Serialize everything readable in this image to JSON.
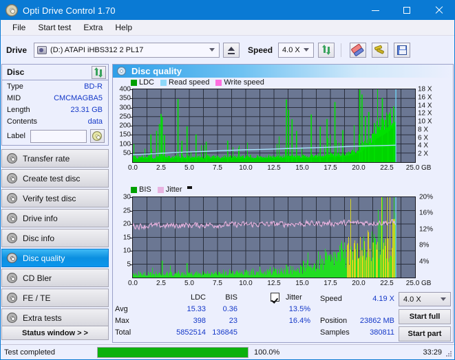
{
  "window": {
    "title": "Opti Drive Control 1.70",
    "icon": "disc-icon",
    "minimize": "minimize-icon",
    "maximize": "maximize-icon",
    "close": "close-icon"
  },
  "menu": {
    "items": [
      "File",
      "Start test",
      "Extra",
      "Help"
    ]
  },
  "toolbar": {
    "drive_label": "Drive",
    "drive_value": "(D:)  ATAPI iHBS312  2 PL17",
    "eject_icon": "eject-icon",
    "speed_label": "Speed",
    "speed_value": "4.0 X",
    "refresh_icon": "refresh-icon",
    "eraser_icon": "eraser-icon",
    "tools_icon": "tools-icon",
    "save_icon": "save-icon"
  },
  "sidebar": {
    "disc_panel": {
      "title": "Disc",
      "refresh_icon": "refresh-icon",
      "rows": [
        {
          "key": "Type",
          "value": "BD-R"
        },
        {
          "key": "MID",
          "value": "CMCMAGBA5"
        },
        {
          "key": "Length",
          "value": "23.31 GB"
        },
        {
          "key": "Contents",
          "value": "data"
        }
      ],
      "label_key": "Label",
      "label_value": "",
      "label_placeholder": "",
      "label_button_icon": "disc-icon"
    },
    "nav": [
      {
        "label": "Transfer rate",
        "selected": false
      },
      {
        "label": "Create test disc",
        "selected": false
      },
      {
        "label": "Verify test disc",
        "selected": false
      },
      {
        "label": "Drive info",
        "selected": false
      },
      {
        "label": "Disc info",
        "selected": false
      },
      {
        "label": "Disc quality",
        "selected": true
      },
      {
        "label": "CD Bler",
        "selected": false
      },
      {
        "label": "FE / TE",
        "selected": false
      },
      {
        "label": "Extra tests",
        "selected": false
      }
    ],
    "status_window_button": "Status window > >"
  },
  "main": {
    "header_title": "Disc quality",
    "header_icon": "disc-icon"
  },
  "chart_data": [
    {
      "type": "area",
      "title": "LDC / Read speed",
      "xlabel": "GB",
      "ylabel": "LDC",
      "xlim": [
        0,
        25.0
      ],
      "ylim": [
        0,
        400
      ],
      "y2lim": [
        0,
        18
      ],
      "y2label": "X",
      "grid": true,
      "legend_position": "top-left",
      "legend": [
        {
          "name": "LDC",
          "color": "#00a000"
        },
        {
          "name": "Read speed",
          "color": "#8fd8f8"
        },
        {
          "name": "Write speed",
          "color": "#ff6fe0"
        }
      ],
      "xticks": [
        "0.0",
        "2.5",
        "5.0",
        "7.5",
        "10.0",
        "12.5",
        "15.0",
        "17.5",
        "20.0",
        "22.5",
        "25.0 GB"
      ],
      "yticks": [
        50,
        100,
        150,
        200,
        250,
        300,
        350,
        400
      ],
      "y2ticks": [
        "2 X",
        "4 X",
        "6 X",
        "8 X",
        "10 X",
        "12 X",
        "14 X",
        "16 X",
        "18 X"
      ],
      "data_end_gb": 23.3,
      "series": [
        {
          "name": "LDC",
          "color": "#00d400",
          "note": "dense green spikes, baseline ~20-40 rising to ~150-250 after 20GB",
          "baseline": [
            28,
            22,
            25,
            30,
            26,
            24,
            32,
            27,
            23,
            26,
            29,
            25,
            31,
            24,
            27,
            22,
            26,
            30,
            28,
            24,
            27,
            25,
            29,
            26,
            23,
            28,
            31,
            26,
            24,
            27,
            30,
            25,
            28,
            26,
            29,
            24,
            27,
            31,
            26,
            28,
            25,
            30,
            27,
            24,
            29,
            26,
            28,
            31,
            27,
            25,
            30,
            28,
            26,
            29,
            27,
            31,
            28,
            26,
            30,
            29,
            27,
            32,
            30,
            28,
            31,
            29,
            33,
            30,
            28,
            32,
            31,
            29,
            34,
            32,
            30,
            35,
            33,
            31,
            36,
            34,
            38,
            36,
            34,
            40,
            38,
            42,
            40,
            45,
            48,
            52,
            58,
            64,
            72,
            85,
            98,
            112,
            128,
            145,
            160,
            175,
            185,
            195,
            205,
            215,
            228,
            245,
            262
          ],
          "spikes": [
            {
              "x": 1.6,
              "y": 152
            },
            {
              "x": 2.1,
              "y": 172
            },
            {
              "x": 2.35,
              "y": 210
            },
            {
              "x": 2.5,
              "y": 265
            },
            {
              "x": 2.6,
              "y": 248
            },
            {
              "x": 2.8,
              "y": 150
            },
            {
              "x": 4.0,
              "y": 346
            },
            {
              "x": 4.35,
              "y": 118
            },
            {
              "x": 4.8,
              "y": 196
            },
            {
              "x": 5.6,
              "y": 152
            },
            {
              "x": 6.5,
              "y": 112
            },
            {
              "x": 8.4,
              "y": 118
            },
            {
              "x": 13.6,
              "y": 344
            },
            {
              "x": 13.8,
              "y": 288
            },
            {
              "x": 14.1,
              "y": 236
            },
            {
              "x": 14.5,
              "y": 172
            },
            {
              "x": 15.8,
              "y": 262
            },
            {
              "x": 16.6,
              "y": 196
            },
            {
              "x": 17.2,
              "y": 237
            },
            {
              "x": 17.9,
              "y": 330
            },
            {
              "x": 18.6,
              "y": 176
            },
            {
              "x": 20.1,
              "y": 398
            },
            {
              "x": 20.3,
              "y": 372
            },
            {
              "x": 20.6,
              "y": 252
            },
            {
              "x": 20.9,
              "y": 276
            },
            {
              "x": 21.4,
              "y": 214
            },
            {
              "x": 22.1,
              "y": 352
            },
            {
              "x": 22.6,
              "y": 262
            },
            {
              "x": 23.1,
              "y": 306
            }
          ]
        },
        {
          "name": "Read speed",
          "color": "#a8e2fb",
          "note": "stepped rising line from ~2.0X to ~4.2X across the disc",
          "points": [
            {
              "x": 0.0,
              "y": 1.85
            },
            {
              "x": 1.2,
              "y": 2.0
            },
            {
              "x": 2.6,
              "y": 2.2
            },
            {
              "x": 4.4,
              "y": 2.45
            },
            {
              "x": 6.2,
              "y": 2.65
            },
            {
              "x": 8.0,
              "y": 2.85
            },
            {
              "x": 10.0,
              "y": 3.05
            },
            {
              "x": 12.0,
              "y": 3.2
            },
            {
              "x": 14.0,
              "y": 3.4
            },
            {
              "x": 16.0,
              "y": 3.55
            },
            {
              "x": 18.0,
              "y": 3.75
            },
            {
              "x": 20.0,
              "y": 3.95
            },
            {
              "x": 22.0,
              "y": 4.1
            },
            {
              "x": 23.3,
              "y": 4.19
            }
          ],
          "end_vertical_gb": 23.3
        },
        {
          "name": "Write speed",
          "color": "#ff6fe0",
          "values": []
        }
      ]
    },
    {
      "type": "area",
      "title": "BIS / Jitter",
      "xlabel": "GB",
      "ylabel": "BIS",
      "xlim": [
        0,
        25.0
      ],
      "ylim": [
        0,
        30
      ],
      "y2lim": [
        0,
        20
      ],
      "y2label": "%",
      "grid": true,
      "legend_position": "top-left",
      "legend": [
        {
          "name": "BIS",
          "color": "#00a000"
        },
        {
          "name": "Jitter",
          "color": "#e8b3e0"
        }
      ],
      "xticks": [
        "0.0",
        "2.5",
        "5.0",
        "7.5",
        "10.0",
        "12.5",
        "15.0",
        "17.5",
        "20.0",
        "22.5",
        "25.0 GB"
      ],
      "yticks": [
        5,
        10,
        15,
        20,
        25,
        30
      ],
      "y2ticks": [
        "4%",
        "8%",
        "12%",
        "16%",
        "20%"
      ],
      "data_end_gb": 23.3,
      "series": [
        {
          "name": "BIS",
          "color": "#22dd22",
          "note": "green noise band ~0-3 rising to ~8-13 after 19GB with yellow peaks near end",
          "baseline": [
            1.2,
            1.0,
            1.5,
            1.1,
            1.3,
            0.9,
            1.4,
            1.2,
            1.0,
            1.6,
            1.2,
            1.3,
            1.1,
            1.5,
            1.2,
            1.4,
            1.0,
            1.3,
            1.6,
            1.2,
            1.4,
            1.1,
            1.5,
            1.3,
            1.2,
            1.6,
            1.4,
            1.2,
            1.5,
            1.3,
            1.7,
            1.4,
            1.2,
            1.6,
            1.5,
            1.3,
            1.8,
            1.5,
            1.3,
            1.7,
            1.6,
            1.4,
            1.9,
            1.6,
            1.4,
            1.8,
            1.7,
            1.5,
            2.0,
            1.8,
            1.6,
            2.1,
            1.9,
            1.7,
            2.2,
            2.0,
            1.8,
            2.4,
            2.2,
            2.0,
            2.6,
            2.4,
            2.2,
            2.9,
            2.7,
            2.5,
            3.4,
            3.1,
            2.9,
            3.9,
            3.6,
            3.3,
            4.6,
            4.3,
            4.0,
            5.4,
            5.1,
            4.8,
            6.3,
            6.0,
            5.7,
            7.2,
            6.9,
            6.6,
            8.1,
            7.8,
            7.5,
            9.0,
            8.7,
            8.4,
            9.6,
            9.3,
            9.0,
            10.2,
            10.6,
            11.0,
            11.8,
            12.4,
            10.5,
            11.2,
            12.8,
            13.0,
            11.5,
            12.2,
            13.4,
            14.8,
            16.2
          ],
          "peaks": [
            {
              "x": 2.6,
              "y": 6.3
            },
            {
              "x": 4.8,
              "y": 5.4
            },
            {
              "x": 13.6,
              "y": 4.8
            },
            {
              "x": 19.7,
              "y": 10.6
            },
            {
              "x": 20.3,
              "y": 10.2
            },
            {
              "x": 21.3,
              "y": 13.1
            },
            {
              "x": 22.6,
              "y": 14.6
            },
            {
              "x": 23.1,
              "y": 21.8
            }
          ]
        },
        {
          "name": "Jitter",
          "color": "#e8b3e0",
          "note": "noisy line oscillating between ~18 and ~23, average ~20.5 (13.5%)",
          "mean": 20.4,
          "min": 16.5,
          "max": 23.8
        }
      ]
    }
  ],
  "stats": {
    "col_headers": [
      "LDC",
      "BIS"
    ],
    "jitter_label": "Jitter",
    "jitter_checked": true,
    "rows": [
      {
        "label": "Avg",
        "ldc": "15.33",
        "bis": "0.36",
        "jitter": "13.5%"
      },
      {
        "label": "Max",
        "ldc": "398",
        "bis": "23",
        "jitter": "16.4%"
      },
      {
        "label": "Total",
        "ldc": "5852514",
        "bis": "136845",
        "jitter": ""
      }
    ],
    "speed_label": "Speed",
    "speed_value": "4.19 X",
    "position_label": "Position",
    "position_value": "23862 MB",
    "samples_label": "Samples",
    "samples_value": "380811",
    "speed_select": "4.0 X",
    "start_full_button": "Start full",
    "start_part_button": "Start part"
  },
  "statusbar": {
    "status_text": "Test completed",
    "progress_percent": "100.0%",
    "progress_value": 100,
    "elapsed": "33:29"
  },
  "colors": {
    "titlebar": "#0a7ad4",
    "accent": "#0a7ad4",
    "value_text": "#1438c8",
    "plot_bg": "#6b7793",
    "ldc_green": "#00d400",
    "read_speed": "#a8e2fb",
    "write_speed": "#ff6fe0",
    "jitter": "#e8b3e0",
    "progress_green": "#0cb10c"
  }
}
